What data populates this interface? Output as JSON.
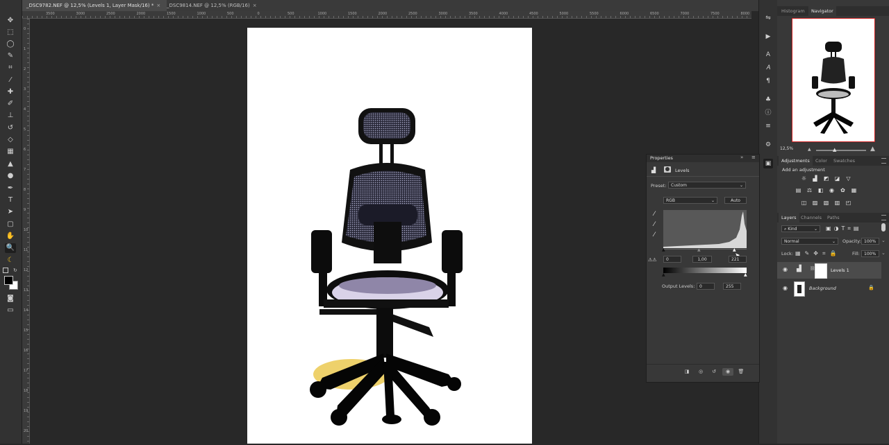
{
  "tabs": [
    {
      "label": "_DSC9782.NEF @ 12,5% (Levels 1, Layer Mask/16) *",
      "close": "×",
      "active": true
    },
    {
      "label": "_DSC9814.NEF @ 12,5% (RGB/16)",
      "close": "×",
      "active": false
    }
  ],
  "ruler": {
    "top_ticks": [
      "3500",
      "3000",
      "2500",
      "2000",
      "1500",
      "1000",
      "500",
      "0",
      "500",
      "1000",
      "1500",
      "2000",
      "2500",
      "3000",
      "3500",
      "4000",
      "4500",
      "5000",
      "5500",
      "6000",
      "6500",
      "7000",
      "7500",
      "8000",
      "8500"
    ],
    "left_ticks": [
      "0",
      "1",
      "2",
      "3",
      "4",
      "5",
      "6",
      "7",
      "8",
      "9",
      "10",
      "11",
      "12",
      "13",
      "14",
      "15",
      "16",
      "17",
      "18",
      "19",
      "20"
    ]
  },
  "navigator": {
    "tabs": [
      "Histogram",
      "Navigator"
    ],
    "zoom": "12,5%"
  },
  "adjustments": {
    "tabs": [
      "Adjustments",
      "Color",
      "Swatches"
    ],
    "add_label": "Add an adjustment"
  },
  "properties": {
    "title": "Properties",
    "panel_name": "Levels",
    "preset_label": "Preset:",
    "preset_value": "Custom",
    "channel_value": "RGB",
    "auto_label": "Auto",
    "input_black": "0",
    "input_gamma": "1,00",
    "input_white": "221",
    "output_label": "Output Levels:",
    "output_black": "0",
    "output_white": "255"
  },
  "layers": {
    "tabs": [
      "Layers",
      "Channels",
      "Paths"
    ],
    "filter_kind": "Kind",
    "blend_mode": "Normal",
    "opacity_label": "Opacity:",
    "opacity_value": "100%",
    "lock_label": "Lock:",
    "fill_label": "Fill:",
    "fill_value": "100%",
    "items": [
      {
        "name": "Levels 1"
      },
      {
        "name": "Background"
      }
    ]
  },
  "icons": {
    "toolbar": [
      "move-icon",
      "marquee-icon",
      "lasso-icon",
      "quick-select-icon",
      "crop-icon",
      "eyedropper-icon",
      "healing-icon",
      "brush-icon",
      "stamp-icon",
      "history-brush-icon",
      "eraser-icon",
      "gradient-icon",
      "blur-icon",
      "dodge-icon",
      "pen-icon",
      "type-icon",
      "path-select-icon",
      "shape-icon",
      "hand-icon",
      "zoom-icon",
      "banana-icon"
    ]
  },
  "colors": {
    "accent_red": "#d02020",
    "panel_bg": "#383838"
  }
}
